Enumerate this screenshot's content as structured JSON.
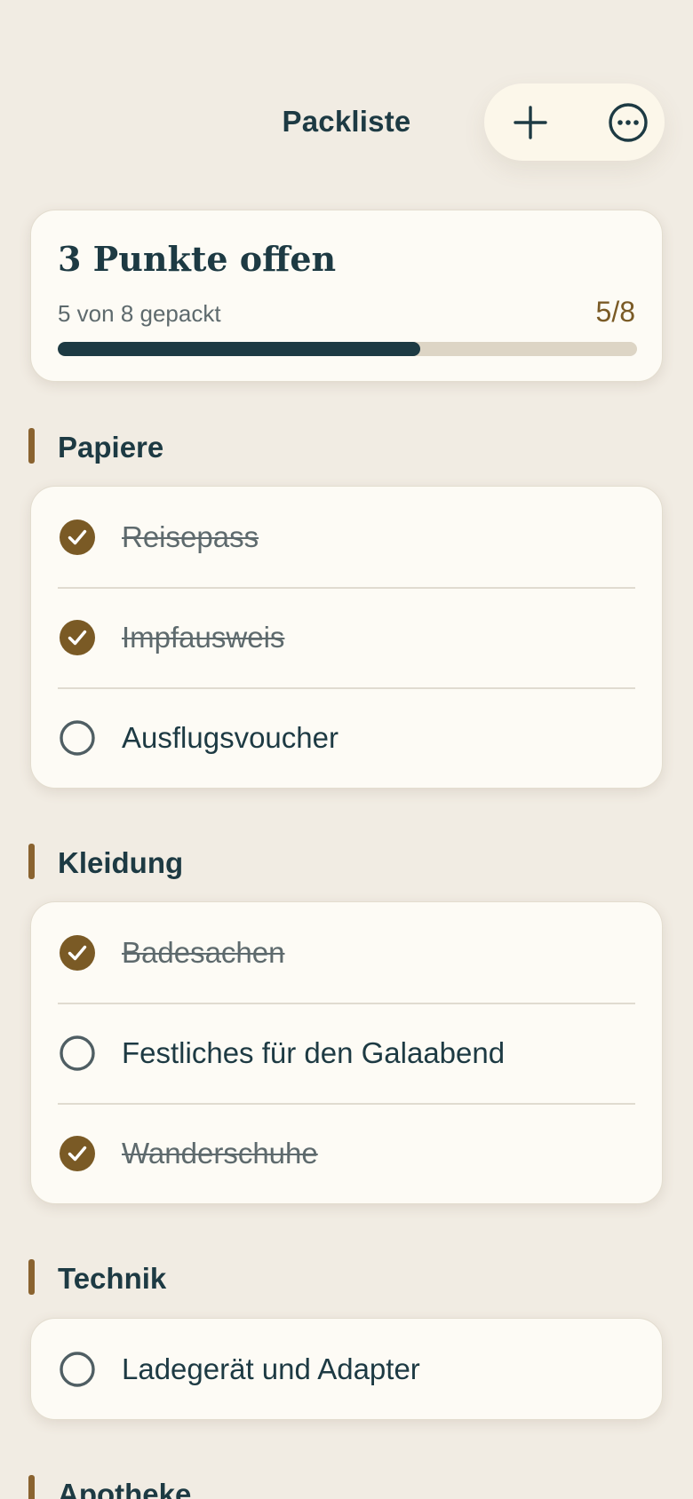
{
  "header": {
    "title": "Packliste",
    "add_icon": "plus-icon",
    "more_icon": "ellipsis-circle-icon"
  },
  "summary": {
    "title": "3 Punkte offen",
    "subtitle": "5 von 8 gepackt",
    "count": "5/8",
    "progress": 0.625
  },
  "sections": [
    {
      "title": "Papiere",
      "items": [
        {
          "label": "Reisepass",
          "checked": true
        },
        {
          "label": "Impfausweis",
          "checked": true
        },
        {
          "label": "Ausflugsvoucher",
          "checked": false
        }
      ]
    },
    {
      "title": "Kleidung",
      "items": [
        {
          "label": "Badesachen",
          "checked": true
        },
        {
          "label": "Festliches für den Galaabend",
          "checked": false
        },
        {
          "label": "Wanderschuhe",
          "checked": true
        }
      ]
    },
    {
      "title": "Technik",
      "items": [
        {
          "label": "Ladegerät und Adapter",
          "checked": false
        }
      ]
    },
    {
      "title": "Apotheke",
      "items": []
    }
  ],
  "colors": {
    "accent": "#7a5a25",
    "primary": "#1d3a43",
    "background": "#f1ece3",
    "card": "#fdfbf5"
  }
}
